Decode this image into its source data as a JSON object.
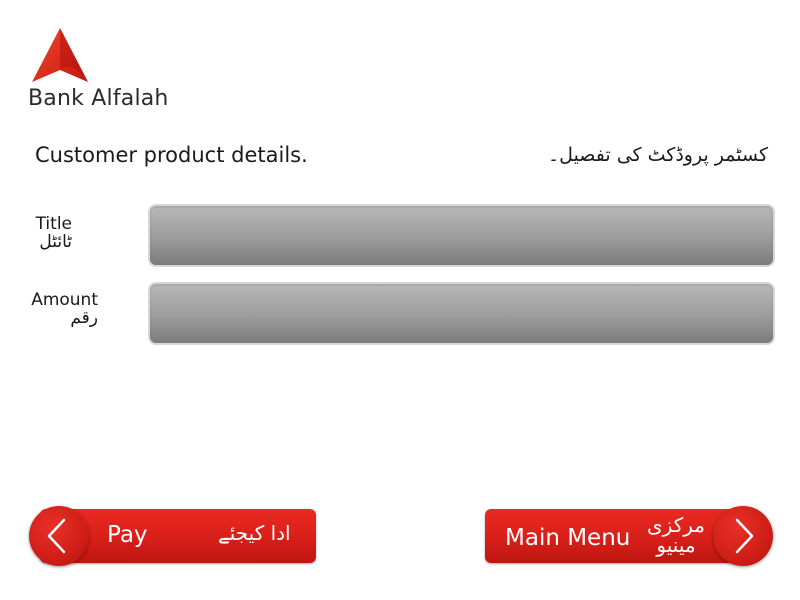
{
  "brand": {
    "name": "Bank Alfalah",
    "logo_color": "#e0241b"
  },
  "heading": {
    "english": "Customer product details.",
    "urdu": "کسٹمر پروڈکٹ کی تفصیل۔"
  },
  "fields": {
    "title": {
      "label_en": "Title",
      "label_ur": "ٹائٹل",
      "value": ""
    },
    "amount": {
      "label_en": "Amount",
      "label_ur": "رقم",
      "value": ""
    }
  },
  "buttons": {
    "pay": {
      "label_en": "Pay",
      "label_ur": "ادا کیجئے",
      "icon": "chevron-left-icon"
    },
    "main_menu": {
      "label_en": "Main Menu",
      "label_ur_line1": "مرکزی",
      "label_ur_line2": "مینیو",
      "icon": "chevron-right-icon"
    }
  },
  "colors": {
    "accent": "#d81f19",
    "field_gray": "#9c9c9c",
    "text": "#1a1a1a"
  }
}
